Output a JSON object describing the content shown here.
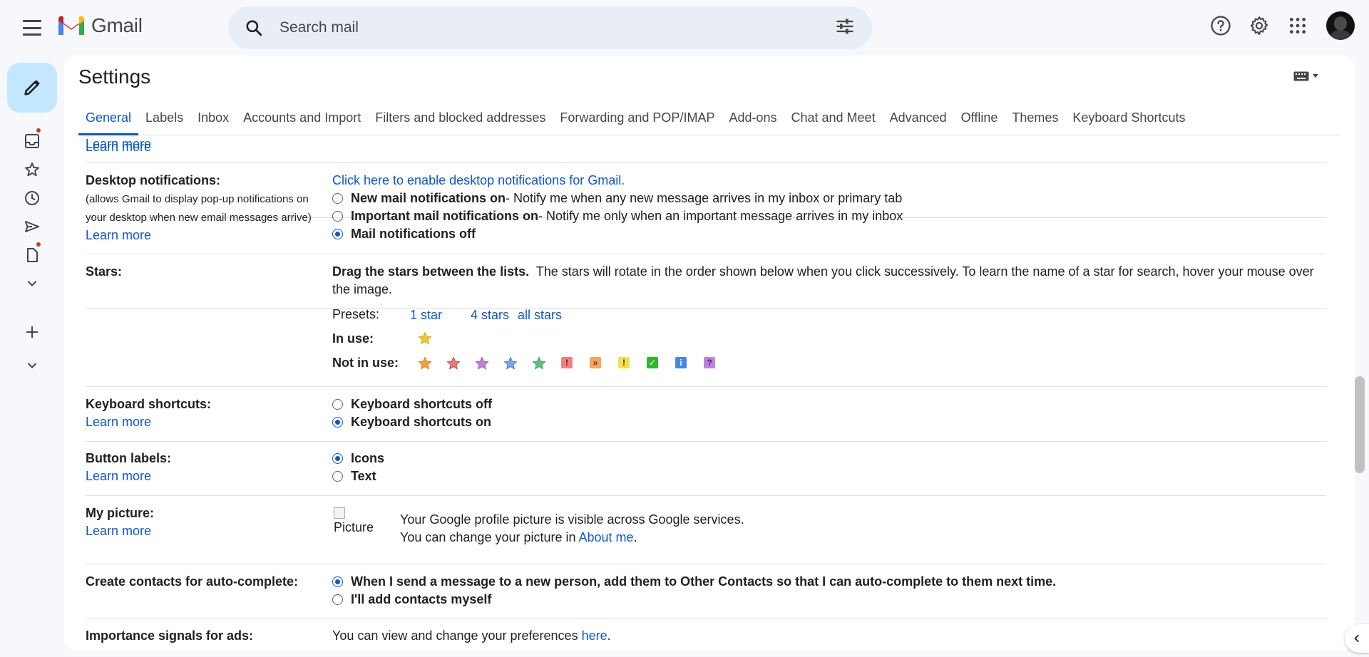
{
  "header": {
    "app_name": "Gmail",
    "search_placeholder": "Search mail"
  },
  "settings": {
    "title": "Settings",
    "tabs": [
      {
        "label": "General",
        "active": true
      },
      {
        "label": "Labels"
      },
      {
        "label": "Inbox"
      },
      {
        "label": "Accounts and Import"
      },
      {
        "label": "Filters and blocked addresses"
      },
      {
        "label": "Forwarding and POP/IMAP"
      },
      {
        "label": "Add-ons"
      },
      {
        "label": "Chat and Meet"
      },
      {
        "label": "Advanced"
      },
      {
        "label": "Offline"
      },
      {
        "label": "Themes"
      },
      {
        "label": "Keyboard Shortcuts"
      }
    ],
    "learn_more": "Learn more",
    "desktop": {
      "label": "Desktop notifications:",
      "sub1": "(allows Gmail to display pop-up notifications on",
      "sub2": "your desktop when new email messages arrive)",
      "enable_link": "Click here to enable desktop notifications for Gmail.",
      "opt1_bold": "New mail notifications on",
      "opt1_rest": " - Notify me when any new message arrives in my inbox or primary tab",
      "opt2_bold": "Important mail notifications on",
      "opt2_rest": " - Notify me only when an important message arrives in my inbox",
      "opt3_bold": "Mail notifications off"
    },
    "stars": {
      "label": "Stars:",
      "bold": "Drag the stars between the lists.",
      "line1_rest": "  The stars will rotate in the order shown below when you click successively. To learn the name of a star for search, hover your mouse over",
      "line2": "the image.",
      "presets_label": "Presets:",
      "presets": [
        "1 star",
        "4 stars",
        "all stars"
      ],
      "in_use_label": "In use:",
      "not_in_use_label": "Not in use:",
      "not_in_use_stars": [
        "orange-star",
        "red-star",
        "purple-star",
        "blue-star",
        "green-star"
      ],
      "not_in_use_boxes": [
        {
          "glyph": "!",
          "bg": "#f08080",
          "fg": "#8b0000"
        },
        {
          "glyph": "»",
          "bg": "#f4a460",
          "fg": "#7a3300"
        },
        {
          "glyph": "!",
          "bg": "#f4e04d",
          "fg": "#333333"
        },
        {
          "glyph": "✓",
          "bg": "#2eb82e",
          "fg": "#ffffff"
        },
        {
          "glyph": "i",
          "bg": "#4a86e8",
          "fg": "#ffffff"
        },
        {
          "glyph": "?",
          "bg": "#c27ee8",
          "fg": "#333333"
        }
      ]
    },
    "keyboard": {
      "label": "Keyboard shortcuts:",
      "opt_off": "Keyboard shortcuts off",
      "opt_on": "Keyboard shortcuts on"
    },
    "button_labels": {
      "label": "Button labels:",
      "opt_icons": "Icons",
      "opt_text": "Text"
    },
    "picture": {
      "label": "My picture:",
      "img_alt": "Picture",
      "line1": "Your Google profile picture is visible across Google services.",
      "line2_pre": "You can change your picture in ",
      "line2_link": "About me",
      "line2_post": "."
    },
    "contacts": {
      "label": "Create contacts for auto-complete:",
      "opt1": "When I send a message to a new person, add them to Other Contacts so that I can auto-complete to them next time.",
      "opt2": "I'll add contacts myself"
    },
    "ads": {
      "label": "Importance signals for ads:",
      "text_pre": "You can view and change your preferences ",
      "link": "here",
      "text_post": "."
    }
  }
}
